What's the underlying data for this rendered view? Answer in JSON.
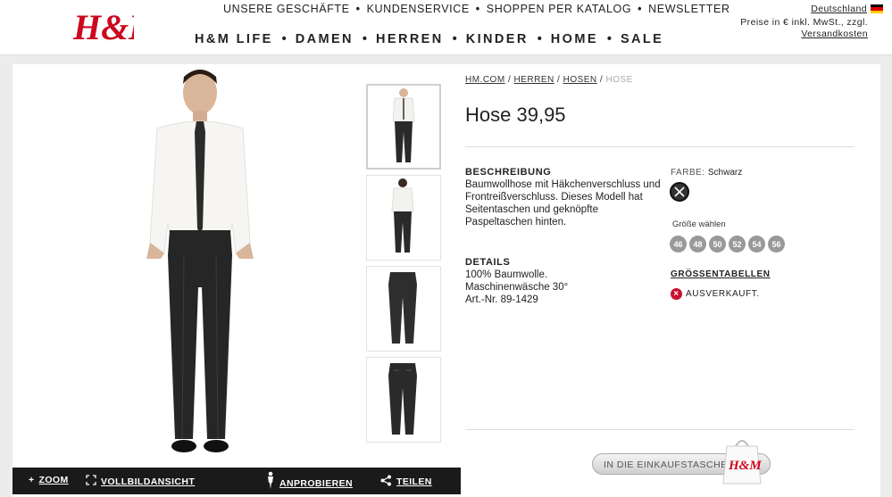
{
  "header": {
    "logo_text": "H&M",
    "top_links": [
      "UNSERE GESCHÄFTE",
      "KUNDENSERVICE",
      "SHOPPEN PER KATALOG",
      "NEWSLETTER"
    ],
    "main_nav": [
      "H&M LIFE",
      "DAMEN",
      "HERREN",
      "KINDER",
      "HOME",
      "SALE"
    ],
    "country": "Deutschland",
    "price_note_line1": "Preise in € inkl. MwSt., zzgl.",
    "price_note_line2": "Versandkosten",
    "brand_color": "#cc071e"
  },
  "gallery": {
    "toolbar": {
      "zoom": "ZOOM",
      "fullscreen": "VOLLBILDANSICHT",
      "try_on": "ANPROBIEREN",
      "share": "TEILEN"
    }
  },
  "product": {
    "breadcrumb": [
      "HM.COM",
      "HERREN",
      "HOSEN",
      "HOSE"
    ],
    "name": "Hose",
    "price": "39,95",
    "description_heading": "BESCHREIBUNG",
    "description": "Baumwollhose mit Häkchenverschluss und Frontreißverschluss. Dieses Modell hat Seitentaschen und geknöpfte Paspeltaschen hinten.",
    "details_heading": "DETAILS",
    "details": [
      "100% Baumwolle.",
      "Maschinenwäsche 30°",
      "Art.-Nr. 89-1429"
    ],
    "color_label": "FARBE:",
    "color_value": "Schwarz",
    "size_heading": "Größe wählen",
    "sizes": [
      "46",
      "48",
      "50",
      "52",
      "54",
      "56"
    ],
    "size_table_link": "GRÖSSENTABELLEN",
    "availability": "AUSVERKAUFT.",
    "add_to_cart": "IN DIE EINKAUFSTASCHE",
    "bag_logo_text": "H&M"
  }
}
